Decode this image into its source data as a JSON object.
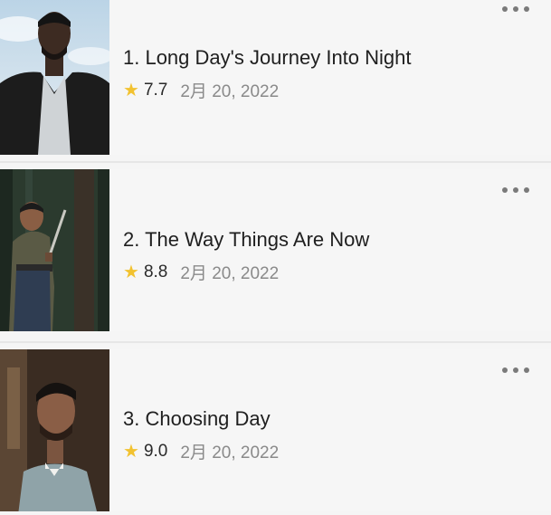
{
  "episodes": [
    {
      "title": "1. Long Day's Journey Into Night",
      "rating": "7.7",
      "date": "2月 20, 2022",
      "thumbnail_icon": "episode-still-man-dark-jacket"
    },
    {
      "title": "2. The Way Things Are Now",
      "rating": "8.8",
      "date": "2月 20, 2022",
      "thumbnail_icon": "episode-still-man-in-forest"
    },
    {
      "title": "3. Choosing Day",
      "rating": "9.0",
      "date": "2月 20, 2022",
      "thumbnail_icon": "episode-still-priest"
    }
  ],
  "icons": {
    "rating": "star-icon",
    "menu": "more-options-icon"
  },
  "colors": {
    "star": "#f2c230",
    "title": "#1f1f1f",
    "date": "#8a8a8a",
    "background": "#f6f6f6"
  }
}
